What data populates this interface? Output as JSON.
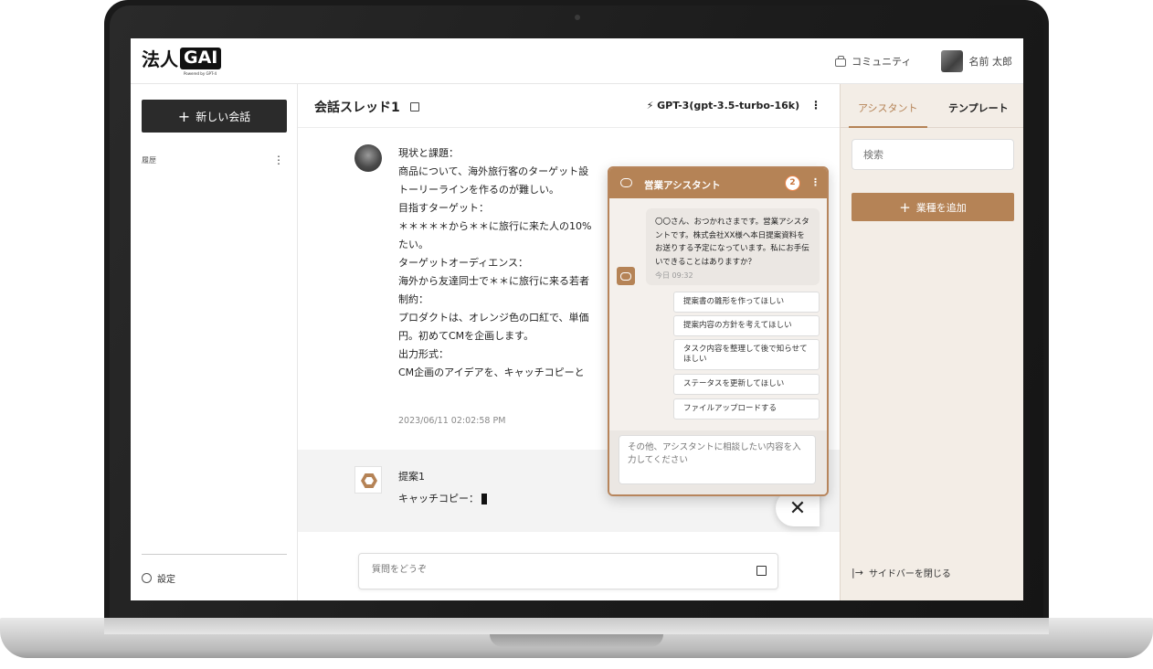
{
  "header": {
    "logo_text": "法人",
    "logo_box": "GAI",
    "logo_sub": "Powered by GPT-4",
    "community": "コミュニティ",
    "user_name": "名前 太郎"
  },
  "sidebar": {
    "new_chat": "新しい会話",
    "history": "履歴",
    "settings": "設定"
  },
  "thread": {
    "title": "会話スレッド1",
    "model": "GPT-3(gpt-3.5-turbo-16k)",
    "user_message": "現状と課題：\n商品について、海外旅行客のターゲット設\nトーリーラインを作るのが難しい。\n目指すターゲット：\n＊＊＊＊＊から＊＊に旅行に来た人の10%\nたい。\nターゲットオーディエンス：\n海外から友達同士で＊＊に旅行に来る若者\n制約：\nプロダクトは、オレンジ色の口紅で、単価\n円。初めてCMを企画します。\n出力形式：\nCM企画のアイデアを、キャッチコピーと",
    "timestamp": "2023/06/11 02:02:58 PM",
    "ai_title": "提案1",
    "ai_text": "キャッチコピー：",
    "ask_placeholder": "質問をどうぞ"
  },
  "assistant_popup": {
    "title": "営業アシスタント",
    "badge": "2",
    "bot_message": "〇〇さん、おつかれさまです。営業アシスタントです。株式会社XX様へ本日提案資料をお送りする予定になっています。私にお手伝いできることはありますか？",
    "bot_time": "今日 09:32",
    "chips": [
      "提案書の雛形を作ってほしい",
      "提案内容の方針を考えてほしい",
      "タスク内容を整理して後で知らせてほしい",
      "ステータスを更新してほしい",
      "ファイルアップロードする"
    ],
    "input_placeholder": "その他、アシスタントに相談したい内容を入力してください"
  },
  "right_sidebar": {
    "tab_assistant": "アシスタント",
    "tab_template": "テンプレート",
    "search_placeholder": "検索",
    "add_button": "業種を追加",
    "close_sidebar": "サイドバーを閉じる"
  },
  "colors": {
    "accent": "#b58356",
    "dark": "#2b2b2b",
    "badge": "#e9844a"
  }
}
